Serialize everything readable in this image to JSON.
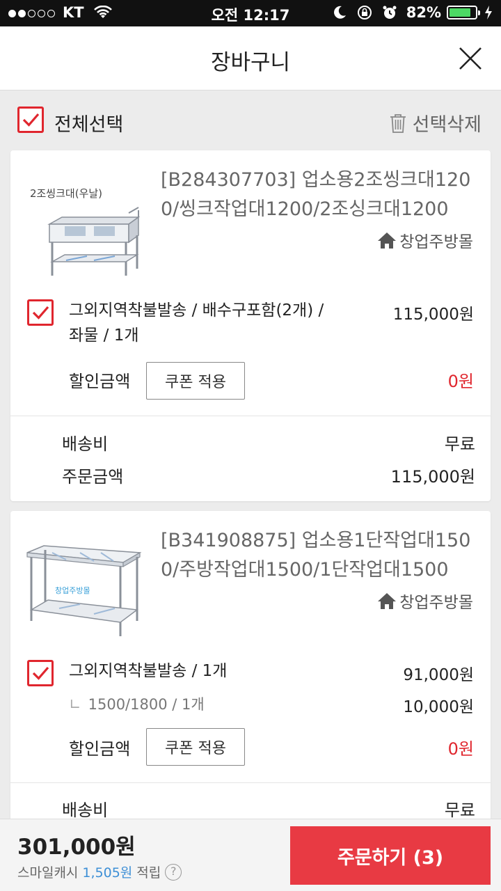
{
  "status_bar": {
    "carrier": "KT",
    "time": "오전 12:17",
    "battery": "82%",
    "battery_level": 0.82
  },
  "header": {
    "title": "장바구니"
  },
  "select_bar": {
    "select_all_label": "전체선택",
    "delete_selected_label": "선택삭제"
  },
  "items": [
    {
      "thumb_label": "2조씽크대(우날)",
      "name": "[B284307703] 업소용2조씽크대1200/씽크작업대1200/2조싱크대1200",
      "seller": "창업주방몰",
      "option": "그외지역착불발송 / 배수구포함(2개) / 좌물 / 1개",
      "option_price": "115,000원",
      "discount_label": "할인금액",
      "coupon_label": "쿠폰 적용",
      "discount_value": "0원",
      "shipping_label": "배송비",
      "shipping_value": "무료",
      "order_label": "주문금액",
      "order_value": "115,000원"
    },
    {
      "thumb_label": "창업주방몰",
      "name": "[B341908875] 업소용1단작업대1500/주방작업대1500/1단작업대1500",
      "seller": "창업주방몰",
      "option": "그외지역착불발송 / 1개",
      "option_price": "91,000원",
      "sub_option": "1500/1800 / 1개",
      "sub_option_price": "10,000원",
      "discount_label": "할인금액",
      "coupon_label": "쿠폰 적용",
      "discount_value": "0원",
      "shipping_label": "배송비",
      "shipping_value": "무료"
    }
  ],
  "bottom_bar": {
    "total": "301,000원",
    "smile_cash_label": "스마일캐시",
    "smile_cash_amount": "1,505원",
    "smile_cash_suffix": "적립",
    "help": "?",
    "order_button": "주문하기 (3)"
  },
  "colors": {
    "accent_red": "#e0262e",
    "order_button": "#e83a43",
    "link_blue": "#3d8fd6",
    "battery_green": "#4cd964"
  }
}
